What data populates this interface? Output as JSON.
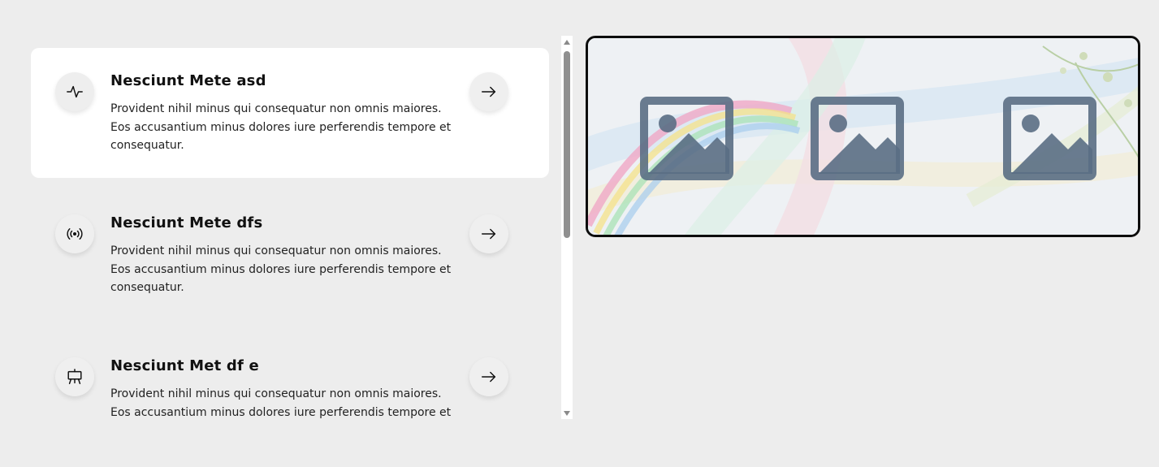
{
  "features": [
    {
      "icon": "activity-icon",
      "title": "Nesciunt Mete asd",
      "description": "Provident nihil minus qui consequatur non omnis maiores. Eos accusantium minus dolores iure perferendis tempore et consequatur.",
      "active": true
    },
    {
      "icon": "broadcast-icon",
      "title": "Nesciunt Mete dfs",
      "description": "Provident nihil minus qui consequatur non omnis maiores. Eos accusantium minus dolores iure perferendis tempore et consequatur.",
      "active": false
    },
    {
      "icon": "easel-icon",
      "title": "Nesciunt Met df e",
      "description": "Provident nihil minus qui consequatur non omnis maiores. Eos accusantium minus dolores iure perferendis tempore et consequatur.",
      "active": false
    }
  ],
  "preview": {
    "placeholder_icon": "image-placeholder-icon",
    "placeholder_count": 3
  },
  "colors": {
    "page_background": "#ededed",
    "active_card": "#ffffff",
    "placeholder_icon": "#5a6e84"
  }
}
